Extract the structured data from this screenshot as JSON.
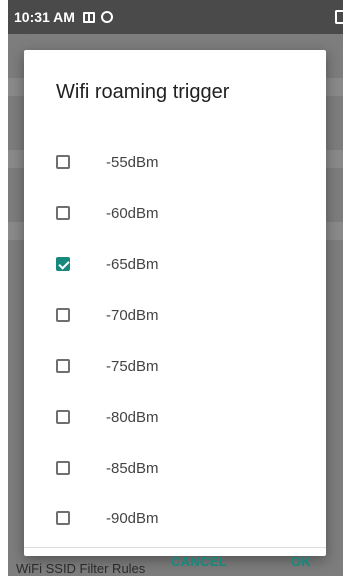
{
  "status_bar": {
    "time": "10:31 AM"
  },
  "dialog": {
    "title": "Wifi roaming trigger",
    "options": [
      {
        "label": "-55dBm",
        "checked": false
      },
      {
        "label": "-60dBm",
        "checked": false
      },
      {
        "label": "-65dBm",
        "checked": true
      },
      {
        "label": "-70dBm",
        "checked": false
      },
      {
        "label": "-75dBm",
        "checked": false
      },
      {
        "label": "-80dBm",
        "checked": false
      },
      {
        "label": "-85dBm",
        "checked": false
      },
      {
        "label": "-90dBm",
        "checked": false
      }
    ],
    "cancel_label": "CANCEL",
    "ok_label": "OK"
  },
  "background": {
    "next_setting_label": "WiFi SSID Filter Rules"
  },
  "colors": {
    "accent": "#16897c",
    "scrim": "#7d7d7d",
    "status_bar": "#4a4a4a"
  },
  "icons": {
    "status_left_1": "notification-square-icon",
    "status_left_2": "sync-circle-icon",
    "status_right": "battery-icon"
  }
}
